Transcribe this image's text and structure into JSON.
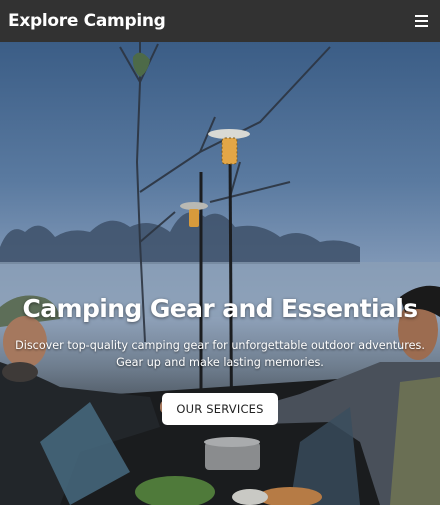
{
  "navbar": {
    "brand": "Explore Camping",
    "menu_icon": "hamburger-menu-icon"
  },
  "hero": {
    "title": "Camping Gear and Essentials",
    "subtitle_line1": "Discover top-quality camping gear for unforgettable outdoor adventures.",
    "subtitle_line2": "Gear up and make lasting memories.",
    "cta_label": "OUR SERVICES"
  },
  "colors": {
    "navbar_bg": "#323232",
    "text": "#ffffff",
    "button_bg": "#ffffff",
    "button_text": "#222222"
  }
}
